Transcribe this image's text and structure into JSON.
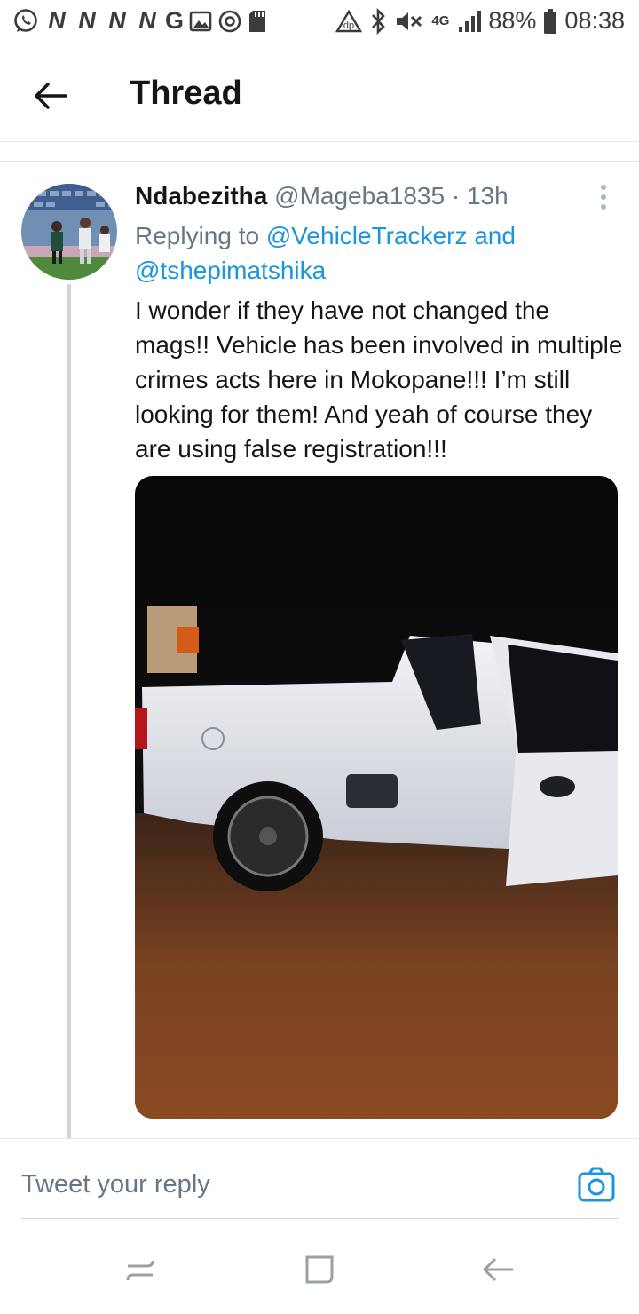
{
  "status_bar": {
    "notification_letters": [
      "N",
      "N",
      "N",
      "N",
      "G"
    ],
    "network": "4G",
    "battery": "88%",
    "time": "08:38"
  },
  "header": {
    "title": "Thread"
  },
  "tweet": {
    "author_name": "Ndabezitha",
    "handle": "@Mageba1835",
    "time_sep": " · ",
    "time": "13h",
    "replying_prefix": "Replying to ",
    "reply_user_1": "@VehicleTrackerz",
    "reply_and": " and",
    "reply_user_2": "@tshepimatshika",
    "text": "I wonder if they have not changed the mags!! Vehicle has been involved in multiple crimes acts here in Mokopane!!! I’m still looking for them! And yeah of course they are using false registration!!!"
  },
  "composer": {
    "placeholder": "Tweet your reply"
  },
  "colors": {
    "link": "#1b95e0",
    "secondary_text": "#657786",
    "divider": "#e1e8ed",
    "thread_line": "#ccd6dd"
  },
  "icons": {
    "back": "back-arrow-icon",
    "more": "more-vertical-icon",
    "camera": "camera-icon",
    "nav_recents": "recents-icon",
    "nav_home": "home-icon",
    "nav_back": "nav-back-icon"
  }
}
